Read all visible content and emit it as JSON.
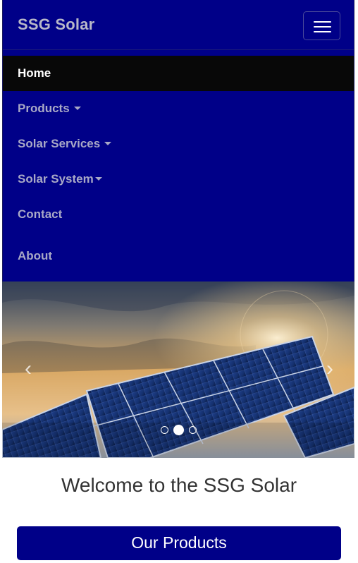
{
  "brand": {
    "name": "SSG Solar"
  },
  "nav": {
    "toggle_icon": "hamburger-icon",
    "items": [
      {
        "label": "Home",
        "active": true,
        "has_caret": false
      },
      {
        "label": "Products",
        "active": false,
        "has_caret": true
      },
      {
        "label": "Solar Services",
        "active": false,
        "has_caret": true
      },
      {
        "label": "Solar System",
        "active": false,
        "has_caret": true
      },
      {
        "label": "Contact",
        "active": false,
        "has_caret": false
      },
      {
        "label": "About",
        "active": false,
        "has_caret": false
      }
    ]
  },
  "carousel": {
    "image": "solar-panels-sunset",
    "prev_icon": "chevron-left-icon",
    "next_icon": "chevron-right-icon",
    "slide_count": 3,
    "active_slide": 2
  },
  "main": {
    "welcome": "Welcome to the SSG Solar",
    "products_button": "Our Products"
  },
  "colors": {
    "navbar": "#000088",
    "active_item": "#080808",
    "nav_text": "#a9a9c6",
    "brand_text": "#b8b8c8",
    "button": "#000088",
    "heading_text": "#333333"
  }
}
